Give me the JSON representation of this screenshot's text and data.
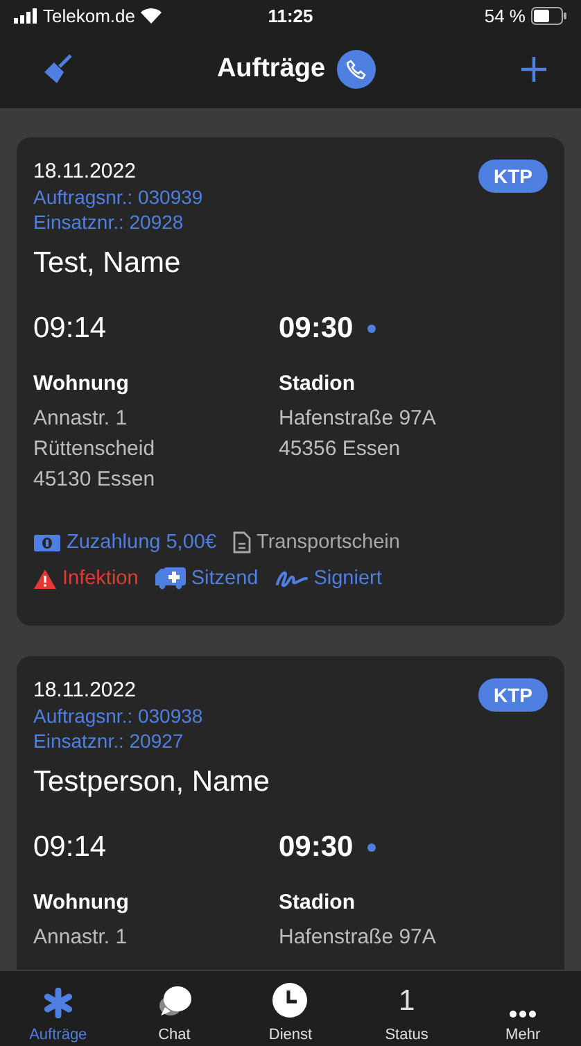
{
  "status_bar": {
    "carrier": "Telekom.de",
    "time": "11:25",
    "battery": "54 %"
  },
  "nav": {
    "title": "Aufträge"
  },
  "orders": [
    {
      "date": "18.11.2022",
      "order_no": "Auftragsnr.: 030939",
      "mission_no": "Einsatznr.: 20928",
      "badge": "KTP",
      "name": "Test, Name",
      "start_time": "09:14",
      "end_time": "09:30",
      "end_dot": true,
      "from": {
        "label": "Wohnung",
        "lines": [
          "Annastr. 1",
          "Rüttenscheid",
          "45130 Essen"
        ]
      },
      "to": {
        "label": "Stadion",
        "lines": [
          "Hafenstraße 97A",
          "45356 Essen"
        ]
      },
      "tags": [
        [
          {
            "kind": "money",
            "text": "Zuzahlung 5,00€",
            "color": "#4f7fe0"
          },
          {
            "kind": "document",
            "text": "Transportschein",
            "color": "#a8a8a8"
          }
        ],
        [
          {
            "kind": "warning",
            "text": "Infektion",
            "color": "#e53935"
          },
          {
            "kind": "ambulance",
            "text": "Sitzend",
            "color": "#4f7fe0"
          },
          {
            "kind": "signature",
            "text": "Signiert",
            "color": "#4f7fe0"
          }
        ]
      ]
    },
    {
      "date": "18.11.2022",
      "order_no": "Auftragsnr.: 030938",
      "mission_no": "Einsatznr.: 20927",
      "badge": "KTP",
      "name": "Testperson, Name",
      "start_time": "09:14",
      "end_time": "09:30",
      "end_dot": true,
      "from": {
        "label": "Wohnung",
        "lines": [
          "Annastr. 1"
        ]
      },
      "to": {
        "label": "Stadion",
        "lines": [
          "Hafenstraße 97A"
        ]
      }
    }
  ],
  "tabs": [
    {
      "kind": "asterisk",
      "label": "Aufträge",
      "selected": true
    },
    {
      "kind": "chat",
      "label": "Chat",
      "selected": false
    },
    {
      "kind": "clock",
      "label": "Dienst",
      "selected": false
    },
    {
      "kind": "count",
      "icon_text": "1",
      "label": "Status",
      "selected": false
    },
    {
      "kind": "more",
      "label": "Mehr",
      "selected": false
    }
  ]
}
